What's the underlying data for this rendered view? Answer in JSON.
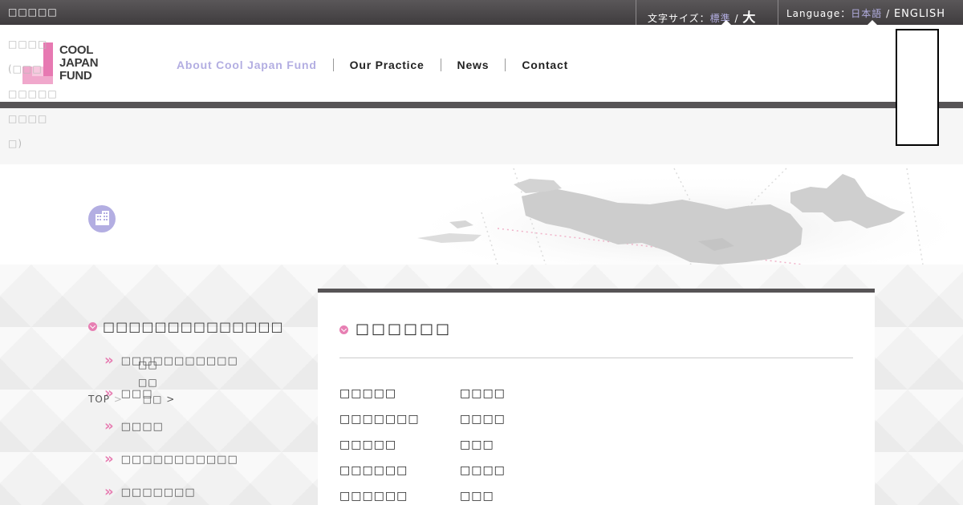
{
  "topbar": {
    "skip_text": "□□□□□",
    "fontsize_label": "文字サイズ：",
    "fontsize_standard": "標準",
    "fontsize_sep": "/",
    "fontsize_large": "大",
    "language_label": "Language：",
    "language_ja": "日本語",
    "language_sep": "/",
    "language_en": "ENGLISH"
  },
  "ghost_lines": [
    "□□□□",
    "(□□□",
    "□□□□□",
    "□□□□",
    "□)"
  ],
  "logo": {
    "line1": "COOL",
    "line2": "JAPAN",
    "line3": "FUND"
  },
  "nav": {
    "items": [
      {
        "label": "About Cool Japan Fund",
        "current": true
      },
      {
        "label": "Our Practice"
      },
      {
        "label": "News"
      },
      {
        "label": "Contact"
      }
    ]
  },
  "sidenav": {
    "title": "□□□□□□□□□□□□□□",
    "items": [
      "□□□□□□□□□□□",
      "□□□",
      "□□□□",
      "□□□□□□□□□□□",
      "□□□□□□□"
    ]
  },
  "breadcrumb": {
    "top": "TOP",
    "sep1": ">",
    "current": "□□",
    "sep2": ">"
  },
  "overlap_lines": [
    "□□",
    "□□",
    "□□"
  ],
  "main": {
    "title": "□□□□□□",
    "rows": [
      {
        "key": "□□□□□",
        "value": "□□□□"
      },
      {
        "key": "□□□□□□□",
        "value": "□□□□"
      },
      {
        "key": "□□□□□",
        "value": "□□□"
      },
      {
        "key": "□□□□□□",
        "value": "□□□□"
      },
      {
        "key": "□□□□□□",
        "value": "□□□"
      }
    ]
  },
  "colors": {
    "accent_lavender": "#b3aee2",
    "accent_pink": "#e77fb3",
    "dark_bar": "#575456"
  },
  "icons": [
    "j-logo-icon",
    "building-icon",
    "chevron-down-icon",
    "double-arrow-icon",
    "japan-map-image"
  ]
}
